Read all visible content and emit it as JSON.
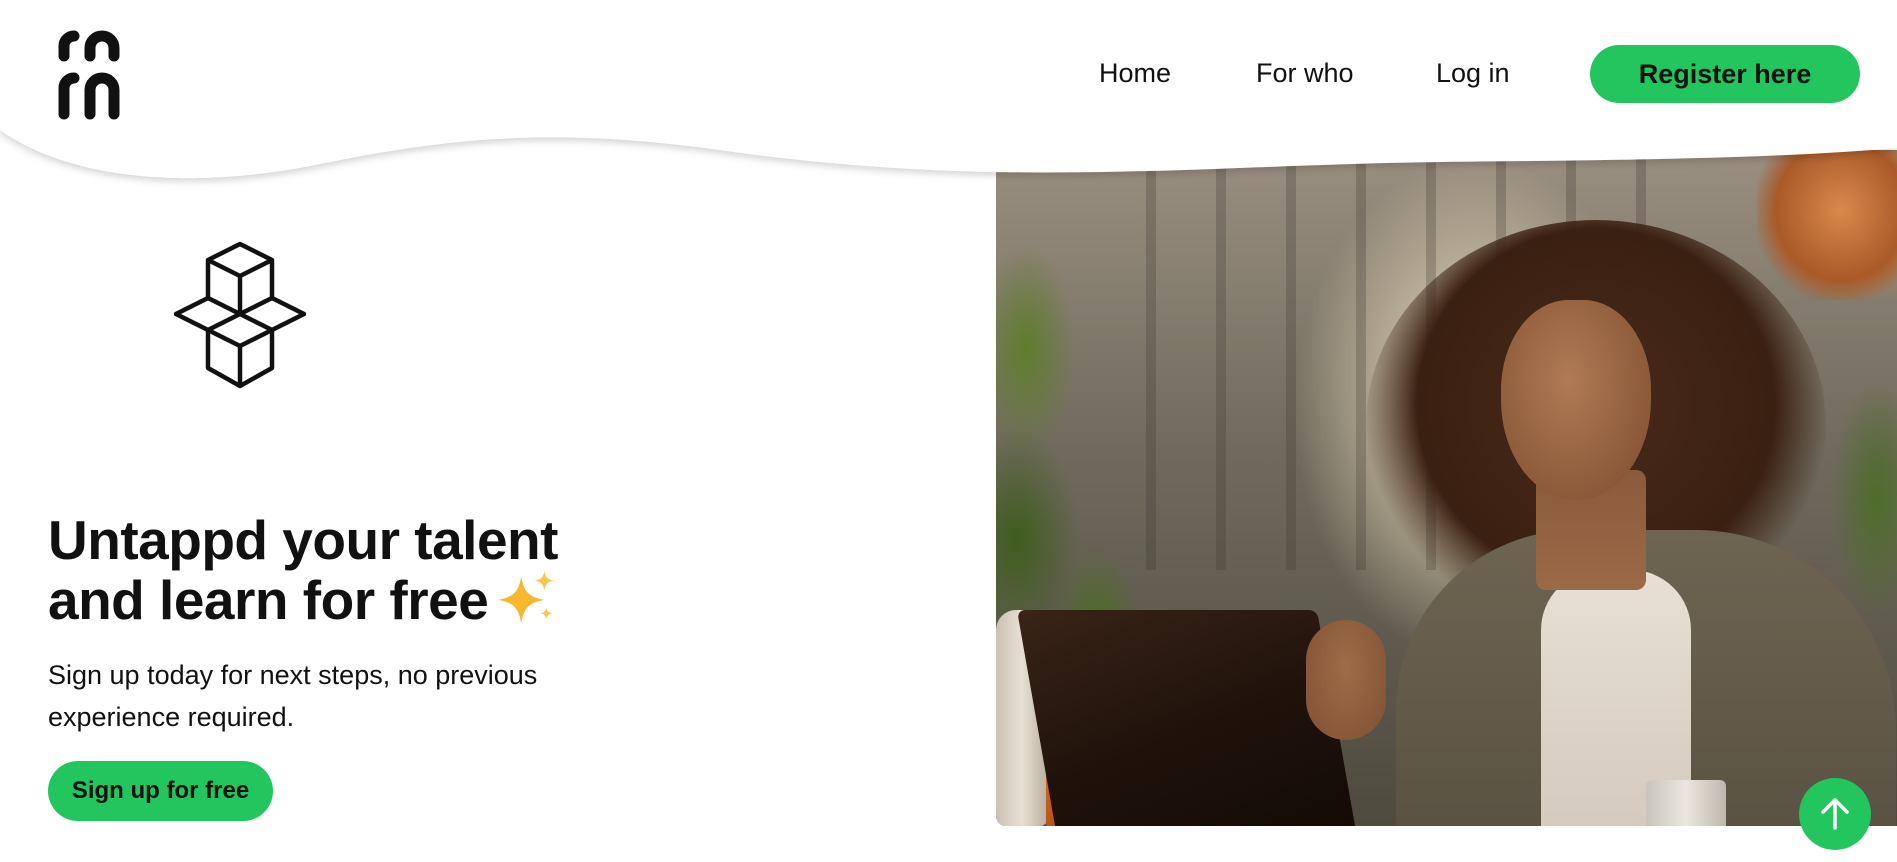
{
  "brand": {
    "logo_icon": "brand-logo-mark"
  },
  "nav": {
    "items": [
      {
        "label": "Home"
      },
      {
        "label": "For who"
      },
      {
        "label": "Log in"
      }
    ],
    "register_label": "Register here"
  },
  "hero": {
    "illustration_icon": "stacked-cubes-icon",
    "title_line1": "Untappd your talent",
    "title_line2": "and learn for free",
    "title_emoji": "sparkles-icon",
    "subtitle": "Sign up today for next steps, no previous experience required.",
    "cta_label": "Sign up for free",
    "image_alt": "woman-working-on-laptop-photo"
  },
  "scroll_top": {
    "icon": "arrow-up-icon"
  },
  "colors": {
    "accent": "#22c55e",
    "text": "#111111",
    "background": "#ffffff",
    "sparkle": "#f5b82e"
  }
}
